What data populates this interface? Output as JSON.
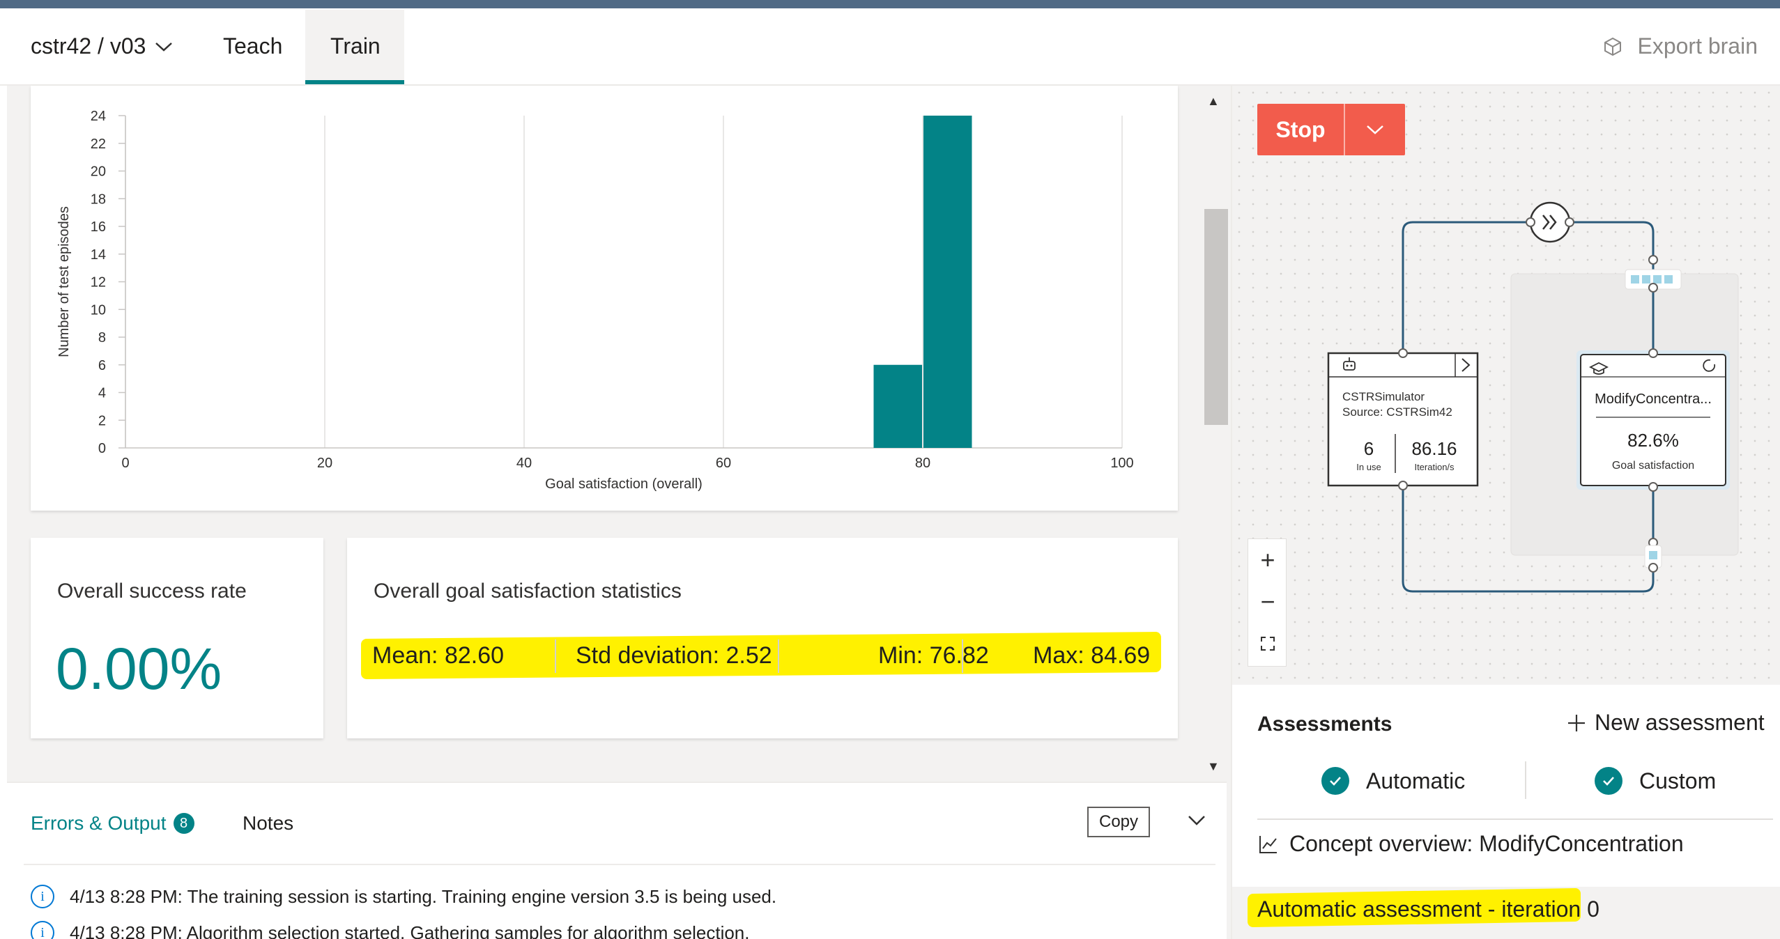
{
  "header": {
    "project": "cstr42 / v03",
    "tabs": [
      {
        "label": "Teach"
      },
      {
        "label": "Train"
      }
    ],
    "active_tab": "Train",
    "export_label": "Export brain"
  },
  "chart_data": {
    "type": "bar",
    "title": "",
    "xlabel": "Goal satisfaction (overall)",
    "ylabel": "Number of test episodes",
    "xlim": [
      0,
      100
    ],
    "ylim": [
      0,
      24
    ],
    "x_ticks": [
      "0",
      "20",
      "40",
      "60",
      "80",
      "100"
    ],
    "y_ticks": [
      "0",
      "2",
      "4",
      "6",
      "8",
      "10",
      "12",
      "14",
      "16",
      "18",
      "20",
      "22",
      "24"
    ],
    "bins": [
      {
        "x_start": 75,
        "x_end": 80,
        "value": 6
      },
      {
        "x_start": 80,
        "x_end": 85,
        "value": 24
      }
    ],
    "grid": "vertical",
    "color": "#038387"
  },
  "success_card": {
    "title": "Overall success rate",
    "value": "0.00%"
  },
  "stats_card": {
    "title": "Overall goal satisfaction statistics",
    "mean": "Mean: 82.60",
    "std": "Std deviation: 2.52",
    "min": "Min: 76.82",
    "max": "Max: 84.69"
  },
  "bottom": {
    "errors_label": "Errors & Output",
    "errors_count": "8",
    "notes_label": "Notes",
    "copy_label": "Copy",
    "logs": [
      "4/13 8:28 PM: The training session is starting. Training engine version 3.5 is being used.",
      "4/13 8:28 PM: Algorithm selection started. Gathering samples for algorithm selection."
    ]
  },
  "right": {
    "stop_label": "Stop",
    "simulator": {
      "name": "CSTRSimulator",
      "source": "Source: CSTRSim42",
      "in_use": "6",
      "in_use_label": "In use",
      "rate": "86.16",
      "rate_label": "Iteration/s"
    },
    "concept": {
      "name": "ModifyConcentra...",
      "value": "82.6%",
      "label": "Goal satisfaction"
    },
    "zoom": {
      "in": "+",
      "out": "−"
    }
  },
  "assessments": {
    "title": "Assessments",
    "new_label": "New assessment",
    "automatic_label": "Automatic",
    "custom_label": "Custom",
    "concept_overview": "Concept overview: ModifyConcentration",
    "auto_row": "Automatic assessment - iteration 0"
  },
  "colors": {
    "accent": "#038387",
    "stop": "#f25c4c",
    "highlight": "#fff100",
    "header_bar": "#506a85"
  }
}
